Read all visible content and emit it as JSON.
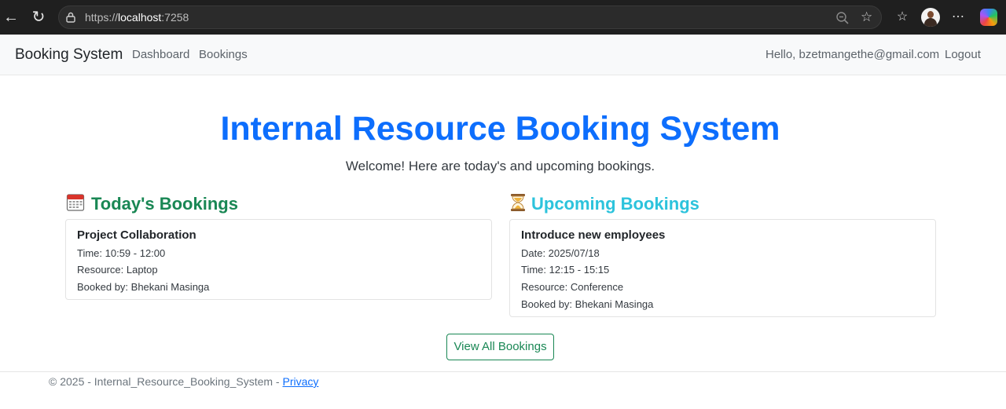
{
  "browser": {
    "url_scheme": "https://",
    "url_host": "localhost",
    "url_port": ":7258"
  },
  "navbar": {
    "brand": "Booking System",
    "links": [
      "Dashboard",
      "Bookings"
    ],
    "greeting": "Hello, bzetmangethe@gmail.com",
    "logout": "Logout"
  },
  "hero": {
    "title": "Internal Resource Booking System",
    "subtitle": "Welcome! Here are today's and upcoming bookings."
  },
  "today": {
    "heading": "Today's Bookings",
    "icon": "calendar-icon",
    "bookings": [
      {
        "title": "Project Collaboration",
        "time": "Time: 10:59 - 12:00",
        "resource": "Resource: Laptop",
        "booked_by": "Booked by: Bhekani Masinga"
      }
    ]
  },
  "upcoming": {
    "heading": "Upcoming Bookings",
    "icon": "hourglass-icon",
    "bookings": [
      {
        "title": "Introduce new employees",
        "date": "Date: 2025/07/18",
        "time": "Time: 12:15 - 15:15",
        "resource": "Resource: Conference",
        "booked_by": "Booked by: Bhekani Masinga"
      }
    ]
  },
  "actions": {
    "view_all": "View All Bookings"
  },
  "footer": {
    "text": "© 2025 - Internal_Resource_Booking_System - ",
    "privacy": "Privacy"
  },
  "colors": {
    "primary": "#0d6efd",
    "success": "#198754",
    "info": "#2cc3dc"
  }
}
